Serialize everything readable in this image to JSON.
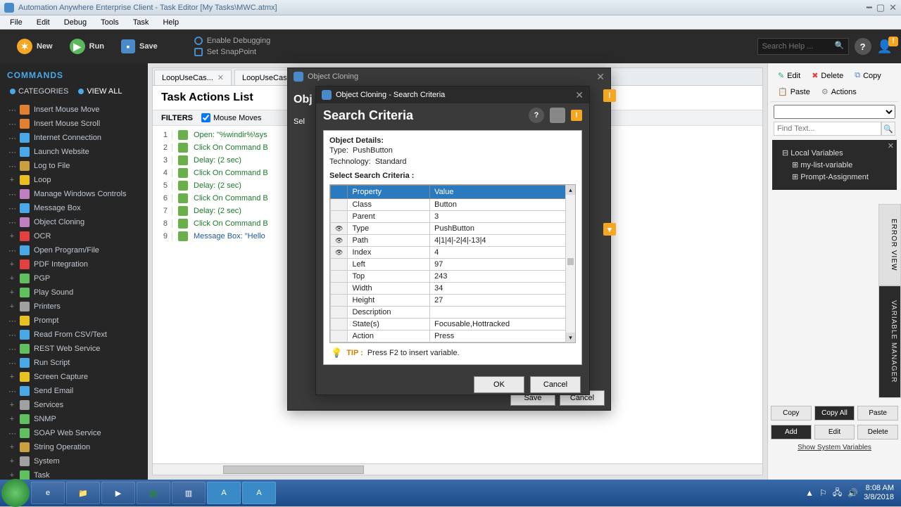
{
  "window": {
    "title": "Automation Anywhere Enterprise Client - Task Editor [My Tasks\\MWC.atmx]"
  },
  "menus": [
    "File",
    "Edit",
    "Debug",
    "Tools",
    "Task",
    "Help"
  ],
  "toolbar": {
    "new": "New",
    "run": "Run",
    "save": "Save",
    "debug1": "Enable Debugging",
    "debug2": "Set SnapPoint",
    "search_ph": "Search Help ..."
  },
  "commands": {
    "title": "COMMANDS",
    "tab_cat": "CATEGORIES",
    "tab_all": "VIEW ALL",
    "items": [
      {
        "l": "Insert Mouse Move",
        "c": "#e08030"
      },
      {
        "l": "Insert Mouse Scroll",
        "c": "#e08030"
      },
      {
        "l": "Internet Connection",
        "c": "#4aa8e8"
      },
      {
        "l": "Launch Website",
        "c": "#4aa8e8"
      },
      {
        "l": "Log to File",
        "c": "#c8a040"
      },
      {
        "l": "Loop",
        "c": "#e8c020",
        "exp": "+"
      },
      {
        "l": "Manage Windows Controls",
        "c": "#c080c0"
      },
      {
        "l": "Message Box",
        "c": "#4aa8e8"
      },
      {
        "l": "Object Cloning",
        "c": "#c080c0"
      },
      {
        "l": "OCR",
        "c": "#e04040",
        "exp": "+"
      },
      {
        "l": "Open Program/File",
        "c": "#4aa8e8"
      },
      {
        "l": "PDF Integration",
        "c": "#e04040",
        "exp": "+"
      },
      {
        "l": "PGP",
        "c": "#60c060",
        "exp": "+"
      },
      {
        "l": "Play Sound",
        "c": "#60c060",
        "exp": "+"
      },
      {
        "l": "Printers",
        "c": "#a0a0a0",
        "exp": "+"
      },
      {
        "l": "Prompt",
        "c": "#e8c020"
      },
      {
        "l": "Read From CSV/Text",
        "c": "#4aa8e8"
      },
      {
        "l": "REST Web Service",
        "c": "#60c060"
      },
      {
        "l": "Run Script",
        "c": "#4aa8e8"
      },
      {
        "l": "Screen Capture",
        "c": "#e8c020",
        "exp": "+"
      },
      {
        "l": "Send Email",
        "c": "#4aa8e8"
      },
      {
        "l": "Services",
        "c": "#a0a0a0",
        "exp": "+"
      },
      {
        "l": "SNMP",
        "c": "#60c060",
        "exp": "+"
      },
      {
        "l": "SOAP Web Service",
        "c": "#60c060"
      },
      {
        "l": "String Operation",
        "c": "#c8a040",
        "exp": "+"
      },
      {
        "l": "System",
        "c": "#a0a0a0",
        "exp": "+"
      },
      {
        "l": "Task",
        "c": "#60c060",
        "exp": "+"
      }
    ]
  },
  "tabs": [
    "LoopUseCas...",
    "LoopUseCas..."
  ],
  "tal": {
    "title": "Task Actions List",
    "filters_label": "FILTERS",
    "mouse_moves": "Mouse Moves"
  },
  "actions": [
    {
      "n": 1,
      "t": "Open: \"%windir%\\sys",
      "c": "open"
    },
    {
      "n": 2,
      "t": "Click On Command B",
      "c": "click"
    },
    {
      "n": 3,
      "t": "Delay: (2 sec)",
      "c": "delay"
    },
    {
      "n": 4,
      "t": "Click On Command B",
      "c": "click"
    },
    {
      "n": 5,
      "t": "Delay: (2 sec)",
      "c": "delay"
    },
    {
      "n": 6,
      "t": "Click On Command B",
      "c": "click"
    },
    {
      "n": 7,
      "t": "Delay: (2 sec)",
      "c": "delay"
    },
    {
      "n": 8,
      "t": "Click On Command B",
      "c": "click"
    },
    {
      "n": 9,
      "t": "Message Box: \"Hello",
      "c": "msg"
    }
  ],
  "rpanel": {
    "edit": "Edit",
    "delete": "Delete",
    "copy": "Copy",
    "paste": "Paste",
    "actions": "Actions",
    "find_ph": "Find Text...",
    "vars_title": "Local Variables",
    "vars": [
      "my-list-variable",
      "Prompt-Assignment"
    ],
    "side1": "ERROR VIEW",
    "side2": "VARIABLE MANAGER",
    "btns": {
      "copy": "Copy",
      "copyall": "Copy All",
      "paste": "Paste",
      "add": "Add",
      "edit": "Edit",
      "del": "Delete"
    },
    "syslink": "Show System Variables"
  },
  "oc_dialog": {
    "title": "Object Cloning",
    "sub": "Obj",
    "sel": "Sel",
    "save": "Save",
    "cancel": "Cancel"
  },
  "sc_dialog": {
    "title": "Object Cloning - Search Criteria",
    "heading": "Search Criteria",
    "details_label": "Object Details:",
    "type_label": "Type:",
    "type_val": "PushButton",
    "tech_label": "Technology:",
    "tech_val": "Standard",
    "select_label": "Select Search Criteria :",
    "col_prop": "Property",
    "col_val": "Value",
    "rows": [
      {
        "sel": false,
        "p": "Class",
        "v": "Button"
      },
      {
        "sel": false,
        "p": "Parent",
        "v": "3"
      },
      {
        "sel": true,
        "p": "Type",
        "v": "PushButton"
      },
      {
        "sel": true,
        "p": "Path",
        "v": "4|1|4|-2|4|-13|4"
      },
      {
        "sel": true,
        "p": "Index",
        "v": "4"
      },
      {
        "sel": false,
        "p": "Left",
        "v": "97"
      },
      {
        "sel": false,
        "p": "Top",
        "v": "243"
      },
      {
        "sel": false,
        "p": "Width",
        "v": "34"
      },
      {
        "sel": false,
        "p": "Height",
        "v": "27"
      },
      {
        "sel": false,
        "p": "Description",
        "v": ""
      },
      {
        "sel": false,
        "p": "State(s)",
        "v": "Focusable,Hottracked"
      },
      {
        "sel": false,
        "p": "Action",
        "v": "Press"
      }
    ],
    "tip_label": "TIP :",
    "tip_text": "Press F2 to insert variable.",
    "ok": "OK",
    "cancel": "Cancel"
  },
  "tray": {
    "time": "8:08 AM",
    "date": "3/8/2018"
  }
}
